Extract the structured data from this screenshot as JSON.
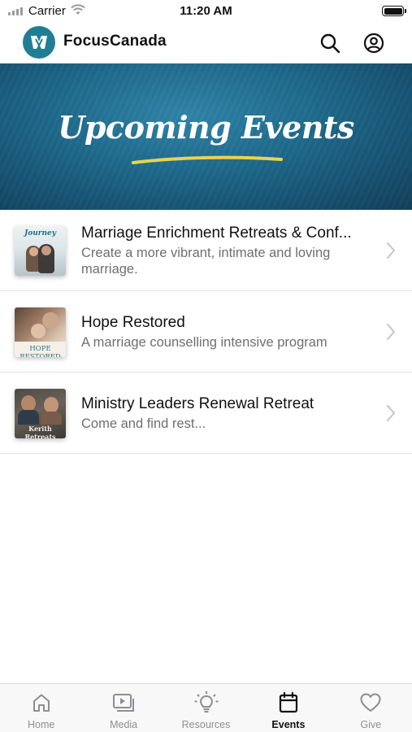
{
  "status_bar": {
    "carrier": "Carrier",
    "time": "11:20 AM"
  },
  "header": {
    "brand": "FocusCanada",
    "search_icon": "search-icon",
    "account_icon": "account-icon"
  },
  "hero": {
    "title": "Upcoming Events"
  },
  "events": [
    {
      "title": "Marriage Enrichment Retreats & Conf...",
      "subtitle": "Create a more vibrant, intimate and loving marriage.",
      "thumb_text": "Journey"
    },
    {
      "title": "Hope Restored",
      "subtitle": "A marriage counselling intensive program",
      "thumb_text": "HOPE RESTORED"
    },
    {
      "title": "Ministry Leaders Renewal Retreat",
      "subtitle": "Come and find rest...",
      "thumb_text": "Kerith Retreats"
    }
  ],
  "tabs": [
    {
      "label": "Home",
      "icon": "home-icon",
      "active": false
    },
    {
      "label": "Media",
      "icon": "media-icon",
      "active": false
    },
    {
      "label": "Resources",
      "icon": "lightbulb-icon",
      "active": false
    },
    {
      "label": "Events",
      "icon": "calendar-icon",
      "active": true
    },
    {
      "label": "Give",
      "icon": "heart-icon",
      "active": false
    }
  ],
  "colors": {
    "brand_teal": "#1f7e94",
    "hero_blue": "#1f6a8c",
    "underline_yellow": "#e8d44d"
  }
}
